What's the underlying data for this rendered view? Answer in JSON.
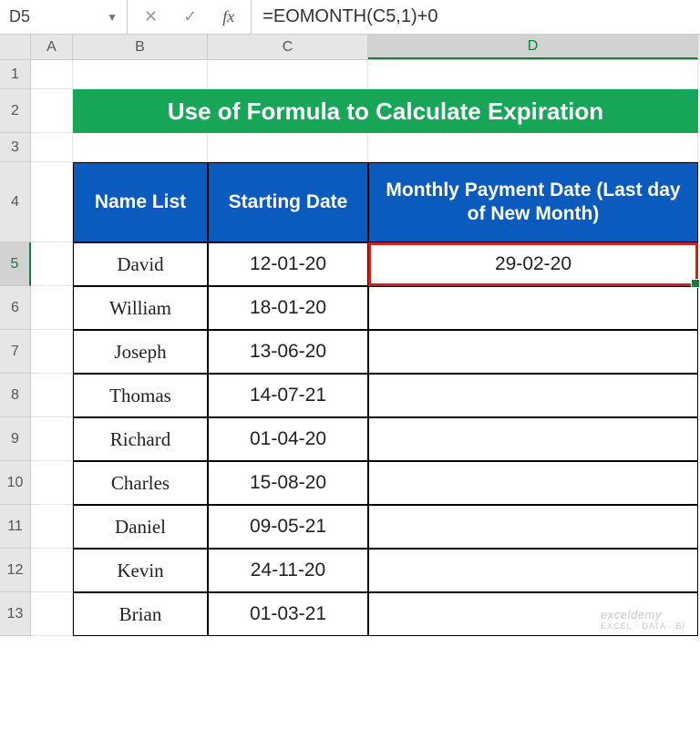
{
  "formula_bar": {
    "name_box": "D5",
    "formula": "=EOMONTH(C5,1)+0"
  },
  "columns": [
    "A",
    "B",
    "C",
    "D"
  ],
  "rows": [
    "1",
    "2",
    "3",
    "4",
    "5",
    "6",
    "7",
    "8",
    "9",
    "10",
    "11",
    "12",
    "13"
  ],
  "active": {
    "col": "D",
    "row": "5"
  },
  "title": "Use of Formula to Calculate Expiration",
  "headers": {
    "name": "Name List",
    "start": "Starting Date",
    "payment": "Monthly Payment Date (Last day of New Month)"
  },
  "table": [
    {
      "name": "David",
      "start": "12-01-20",
      "payment": "29-02-20"
    },
    {
      "name": "William",
      "start": "18-01-20",
      "payment": ""
    },
    {
      "name": "Joseph",
      "start": "13-06-20",
      "payment": ""
    },
    {
      "name": "Thomas",
      "start": "14-07-21",
      "payment": ""
    },
    {
      "name": "Richard",
      "start": "01-04-20",
      "payment": ""
    },
    {
      "name": "Charles",
      "start": "15-08-20",
      "payment": ""
    },
    {
      "name": "Daniel",
      "start": "09-05-21",
      "payment": ""
    },
    {
      "name": "Kevin",
      "start": "24-11-20",
      "payment": ""
    },
    {
      "name": "Brian",
      "start": "01-03-21",
      "payment": ""
    }
  ],
  "watermark": {
    "brand": "exceldemy",
    "tag": "EXCEL · DATA · BI"
  },
  "icons": {
    "dropdown": "▼",
    "cancel": "✕",
    "confirm": "✓",
    "fx": "fx"
  }
}
